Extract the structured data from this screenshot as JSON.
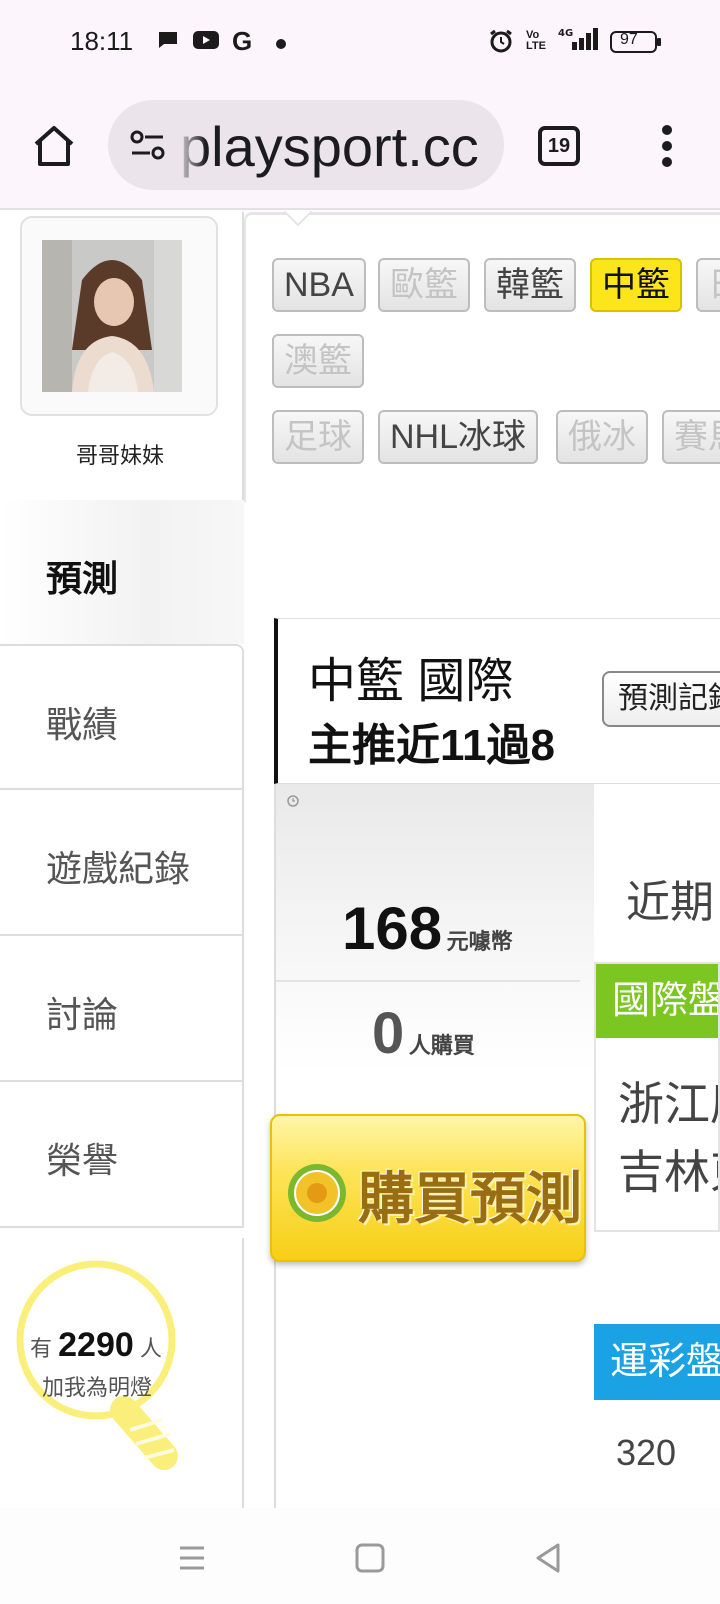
{
  "status_bar": {
    "time": "18:11",
    "battery": "97",
    "network": "4G"
  },
  "browser": {
    "url": "playsport.cc",
    "tab_count": "19"
  },
  "profile": {
    "name": "哥哥妹妹"
  },
  "sidebar": {
    "items": [
      {
        "label": "預測",
        "active": true
      },
      {
        "label": "戰績"
      },
      {
        "label": "遊戲紀錄"
      },
      {
        "label": "討論"
      },
      {
        "label": "榮譽"
      }
    ]
  },
  "fans": {
    "prefix": "有",
    "count": "2290",
    "suffix": "人",
    "subtitle": "加我為明燈"
  },
  "leagues": {
    "row1": [
      "NBA",
      "歐籃",
      "韓籃",
      "中籃",
      "日"
    ],
    "row2": [
      "澳籃"
    ],
    "row3": [
      "足球",
      "NHL冰球",
      "俄冰",
      "賽馬"
    ],
    "active": "中籃"
  },
  "header": {
    "title": "中籃 國際",
    "subtitle": "主推近11過8",
    "record_button": "預測記錄"
  },
  "price": {
    "amount": "168",
    "unit": "元噱幣",
    "buyers": "0",
    "buyers_unit": "人購買",
    "buy_label": "購買預測"
  },
  "recent": {
    "label": "近期"
  },
  "international": {
    "header": "國際盤",
    "teams": [
      "浙江廣",
      "吉林東"
    ]
  },
  "lottery": {
    "header": "運彩盤",
    "value": "320"
  },
  "colors": {
    "active_chip": "#fce51a",
    "green_header": "#7cc621",
    "blue_header": "#1ba2e4"
  }
}
